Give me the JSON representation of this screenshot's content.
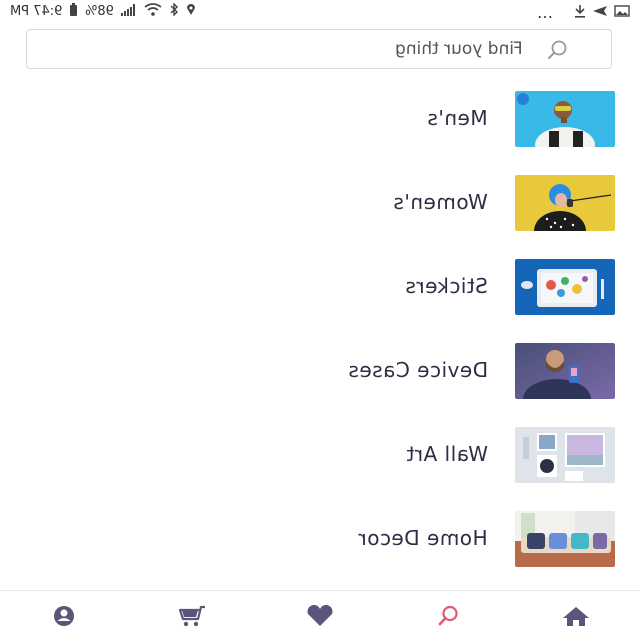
{
  "status_bar": {
    "time": "9:47 PM",
    "battery": "98%",
    "overflow": "…"
  },
  "search": {
    "placeholder": "Find your thing"
  },
  "categories": [
    {
      "label": "Men's"
    },
    {
      "label": "Women's"
    },
    {
      "label": "Stickers"
    },
    {
      "label": "Device Cases"
    },
    {
      "label": "Wall Art"
    },
    {
      "label": "Home Decor"
    }
  ],
  "bottom_nav": {
    "items": [
      {
        "icon": "home-icon"
      },
      {
        "icon": "search-icon",
        "active": true
      },
      {
        "icon": "heart-icon"
      },
      {
        "icon": "cart-icon"
      },
      {
        "icon": "account-icon"
      }
    ]
  },
  "colors": {
    "nav_icon": "#5c547a",
    "nav_active": "#e05a78",
    "text": "#2f2d45"
  }
}
